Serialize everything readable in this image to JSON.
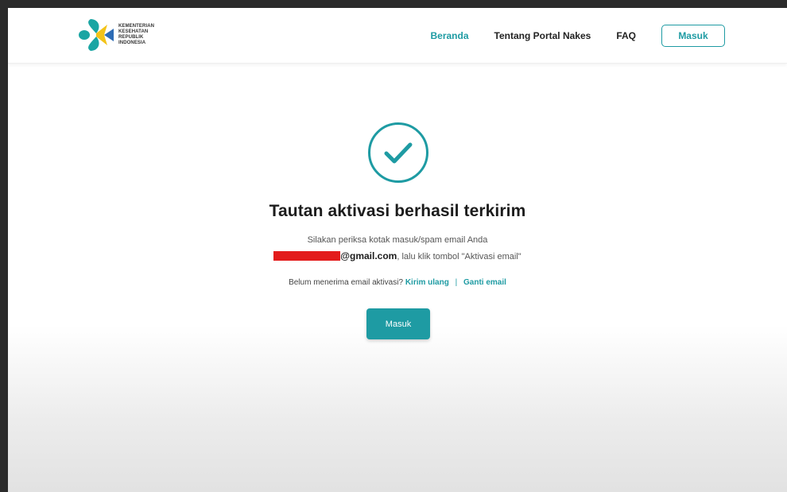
{
  "logo": {
    "lines": [
      "KEMENTERIAN",
      "KESEHATAN",
      "REPUBLIK",
      "INDONESIA"
    ]
  },
  "nav": {
    "items": [
      {
        "label": "Beranda",
        "active": true
      },
      {
        "label": "Tentang Portal Nakes",
        "active": false
      },
      {
        "label": "FAQ",
        "active": false
      }
    ],
    "login_label": "Masuk"
  },
  "main": {
    "icon": "check-circle-icon",
    "title": "Tautan aktivasi berhasil terkirim",
    "desc_line1": "Silakan periksa kotak masuk/spam email Anda",
    "email_suffix": "@gmail.com",
    "desc_line2_rest": ", lalu klik tombol \"Aktivasi email\"",
    "resend_prompt": "Belum menerima email aktivasi?",
    "resend_link": "Kirim ulang",
    "separator": "|",
    "change_email_link": "Ganti email",
    "button_label": "Masuk"
  },
  "colors": {
    "accent": "#1e9ba3",
    "redaction": "#e31b1b",
    "logo_teal": "#1aa5a3",
    "logo_yellow": "#f3c318",
    "logo_blue": "#2d6cb5"
  }
}
